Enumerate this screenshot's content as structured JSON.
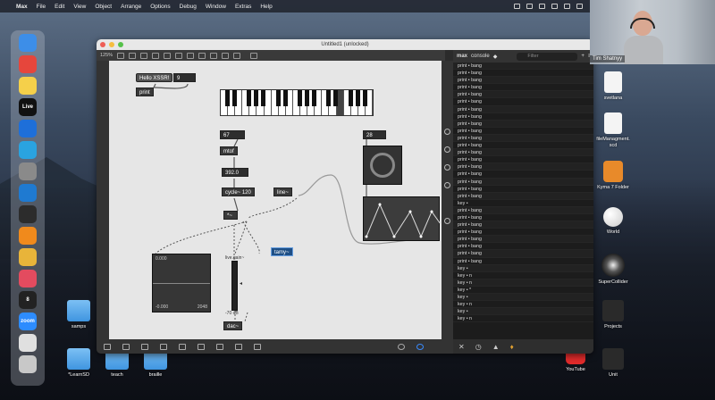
{
  "menubar": {
    "app": "Max",
    "items": [
      "File",
      "Edit",
      "View",
      "Object",
      "Arrange",
      "Options",
      "Debug",
      "Window",
      "Extras",
      "Help"
    ]
  },
  "dock": {
    "apps": [
      {
        "name": "finder-icon",
        "label": "",
        "color": "#3d8ee8"
      },
      {
        "name": "launchpad-icon",
        "label": "",
        "color": "#e6463c"
      },
      {
        "name": "notes-icon",
        "label": "",
        "color": "#f5d04a"
      },
      {
        "name": "live-icon",
        "label": "Live",
        "color": "#111111"
      },
      {
        "name": "safari-icon",
        "label": "",
        "color": "#1e6fd9"
      },
      {
        "name": "telegram-icon",
        "label": "",
        "color": "#2aa3e0"
      },
      {
        "name": "settings-icon",
        "label": "",
        "color": "#8a8a8a"
      },
      {
        "name": "vscode-icon",
        "label": "",
        "color": "#1f7ad1"
      },
      {
        "name": "supercollider-icon",
        "label": "",
        "color": "#2c2c2c"
      },
      {
        "name": "books-icon",
        "label": "",
        "color": "#f08a1c"
      },
      {
        "name": "photos-icon",
        "label": "",
        "color": "#e8b43a"
      },
      {
        "name": "music-icon",
        "label": "",
        "color": "#e34b5f"
      },
      {
        "name": "max-icon",
        "label": "8",
        "color": "#222222"
      },
      {
        "name": "zoom-icon",
        "label": "zoom",
        "color": "#2d8cff"
      },
      {
        "name": "textedit-icon",
        "label": "",
        "color": "#e0e0e0"
      },
      {
        "name": "trash-icon",
        "label": "",
        "color": "#c8c8c8"
      }
    ]
  },
  "window": {
    "title": "Untitled1 (unlocked)",
    "zoom": "125%"
  },
  "patch": {
    "hello_msg": "Hello XSSR!",
    "num_9": "9",
    "print": "print",
    "num_67": "67",
    "mtof": "mtof",
    "num_28": "28",
    "num_freq": "392.0",
    "cycle": "cycle~ 120",
    "line": "line~",
    "times": "*~",
    "spec": "live.gain~",
    "scope_top": "0.000",
    "scope_bottom": "-0.000",
    "scope_right": "2048",
    "selected": "tamy~",
    "dac": "dac~",
    "meter_label": "-70 dB"
  },
  "console": {
    "title": "max",
    "subtitle": "console",
    "filter_placeholder": "Filter",
    "lines": [
      "print • bang",
      "print • bang",
      "print • bang",
      "print • bang",
      "print • bang",
      "print • bang",
      "print • bang",
      "print • bang",
      "print • bang",
      "print • bang",
      "print • bang",
      "print • bang",
      "print • bang",
      "print • bang",
      "print • bang",
      "print • bang",
      "print • bang",
      "print • bang",
      "print • bang",
      "key • ",
      "print • bang",
      "print • bang",
      "print • bang",
      "print • bang",
      "print • bang",
      "print • bang",
      "print • bang",
      "print • bang",
      "key • ",
      "key • n",
      "key • n",
      "key • *",
      "key • ",
      "key • n",
      "key • ",
      "key • n"
    ]
  },
  "desktop": {
    "icons": [
      {
        "name": "svetlana-doc",
        "label": "svetlana"
      },
      {
        "name": "filemanagement-doc",
        "label": "fileManagment.\nscd"
      },
      {
        "name": "kyma-folder",
        "label": "Kyma 7 Folder"
      },
      {
        "name": "world-icon",
        "label": "World"
      },
      {
        "name": "supercollider-app",
        "label": "SuperCollider"
      },
      {
        "name": "projects-folder",
        "label": "Projects"
      },
      {
        "name": "youtube-icon",
        "label": "YouTube"
      },
      {
        "name": "unit-folder",
        "label": "Unit"
      },
      {
        "name": "samps-folder",
        "label": "samps"
      },
      {
        "name": "learnsd-folder",
        "label": "*LearnSD"
      },
      {
        "name": "teach-folder",
        "label": "teach"
      },
      {
        "name": "braille-folder",
        "label": "braille"
      }
    ]
  },
  "webcam": {
    "name": "Tim Shatnyy"
  }
}
